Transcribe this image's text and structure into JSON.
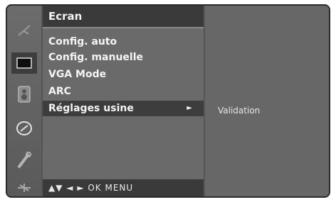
{
  "menu": {
    "title": "Ecran",
    "items": [
      {
        "label": "Config. auto"
      },
      {
        "label": "Config. manuelle"
      },
      {
        "label": "VGA Mode"
      },
      {
        "label": "ARC"
      },
      {
        "label": "Réglages usine",
        "arrow": "►",
        "selected": true
      }
    ],
    "footer": "▲▼  ◄ ►  OK  MENU"
  },
  "panel": {
    "label": "Validation"
  },
  "icons": [
    {
      "name": "antenna-icon"
    },
    {
      "name": "screen-icon",
      "active": true
    },
    {
      "name": "speaker-icon"
    },
    {
      "name": "clock-icon"
    },
    {
      "name": "wrench-icon"
    },
    {
      "name": "input-icon"
    }
  ]
}
